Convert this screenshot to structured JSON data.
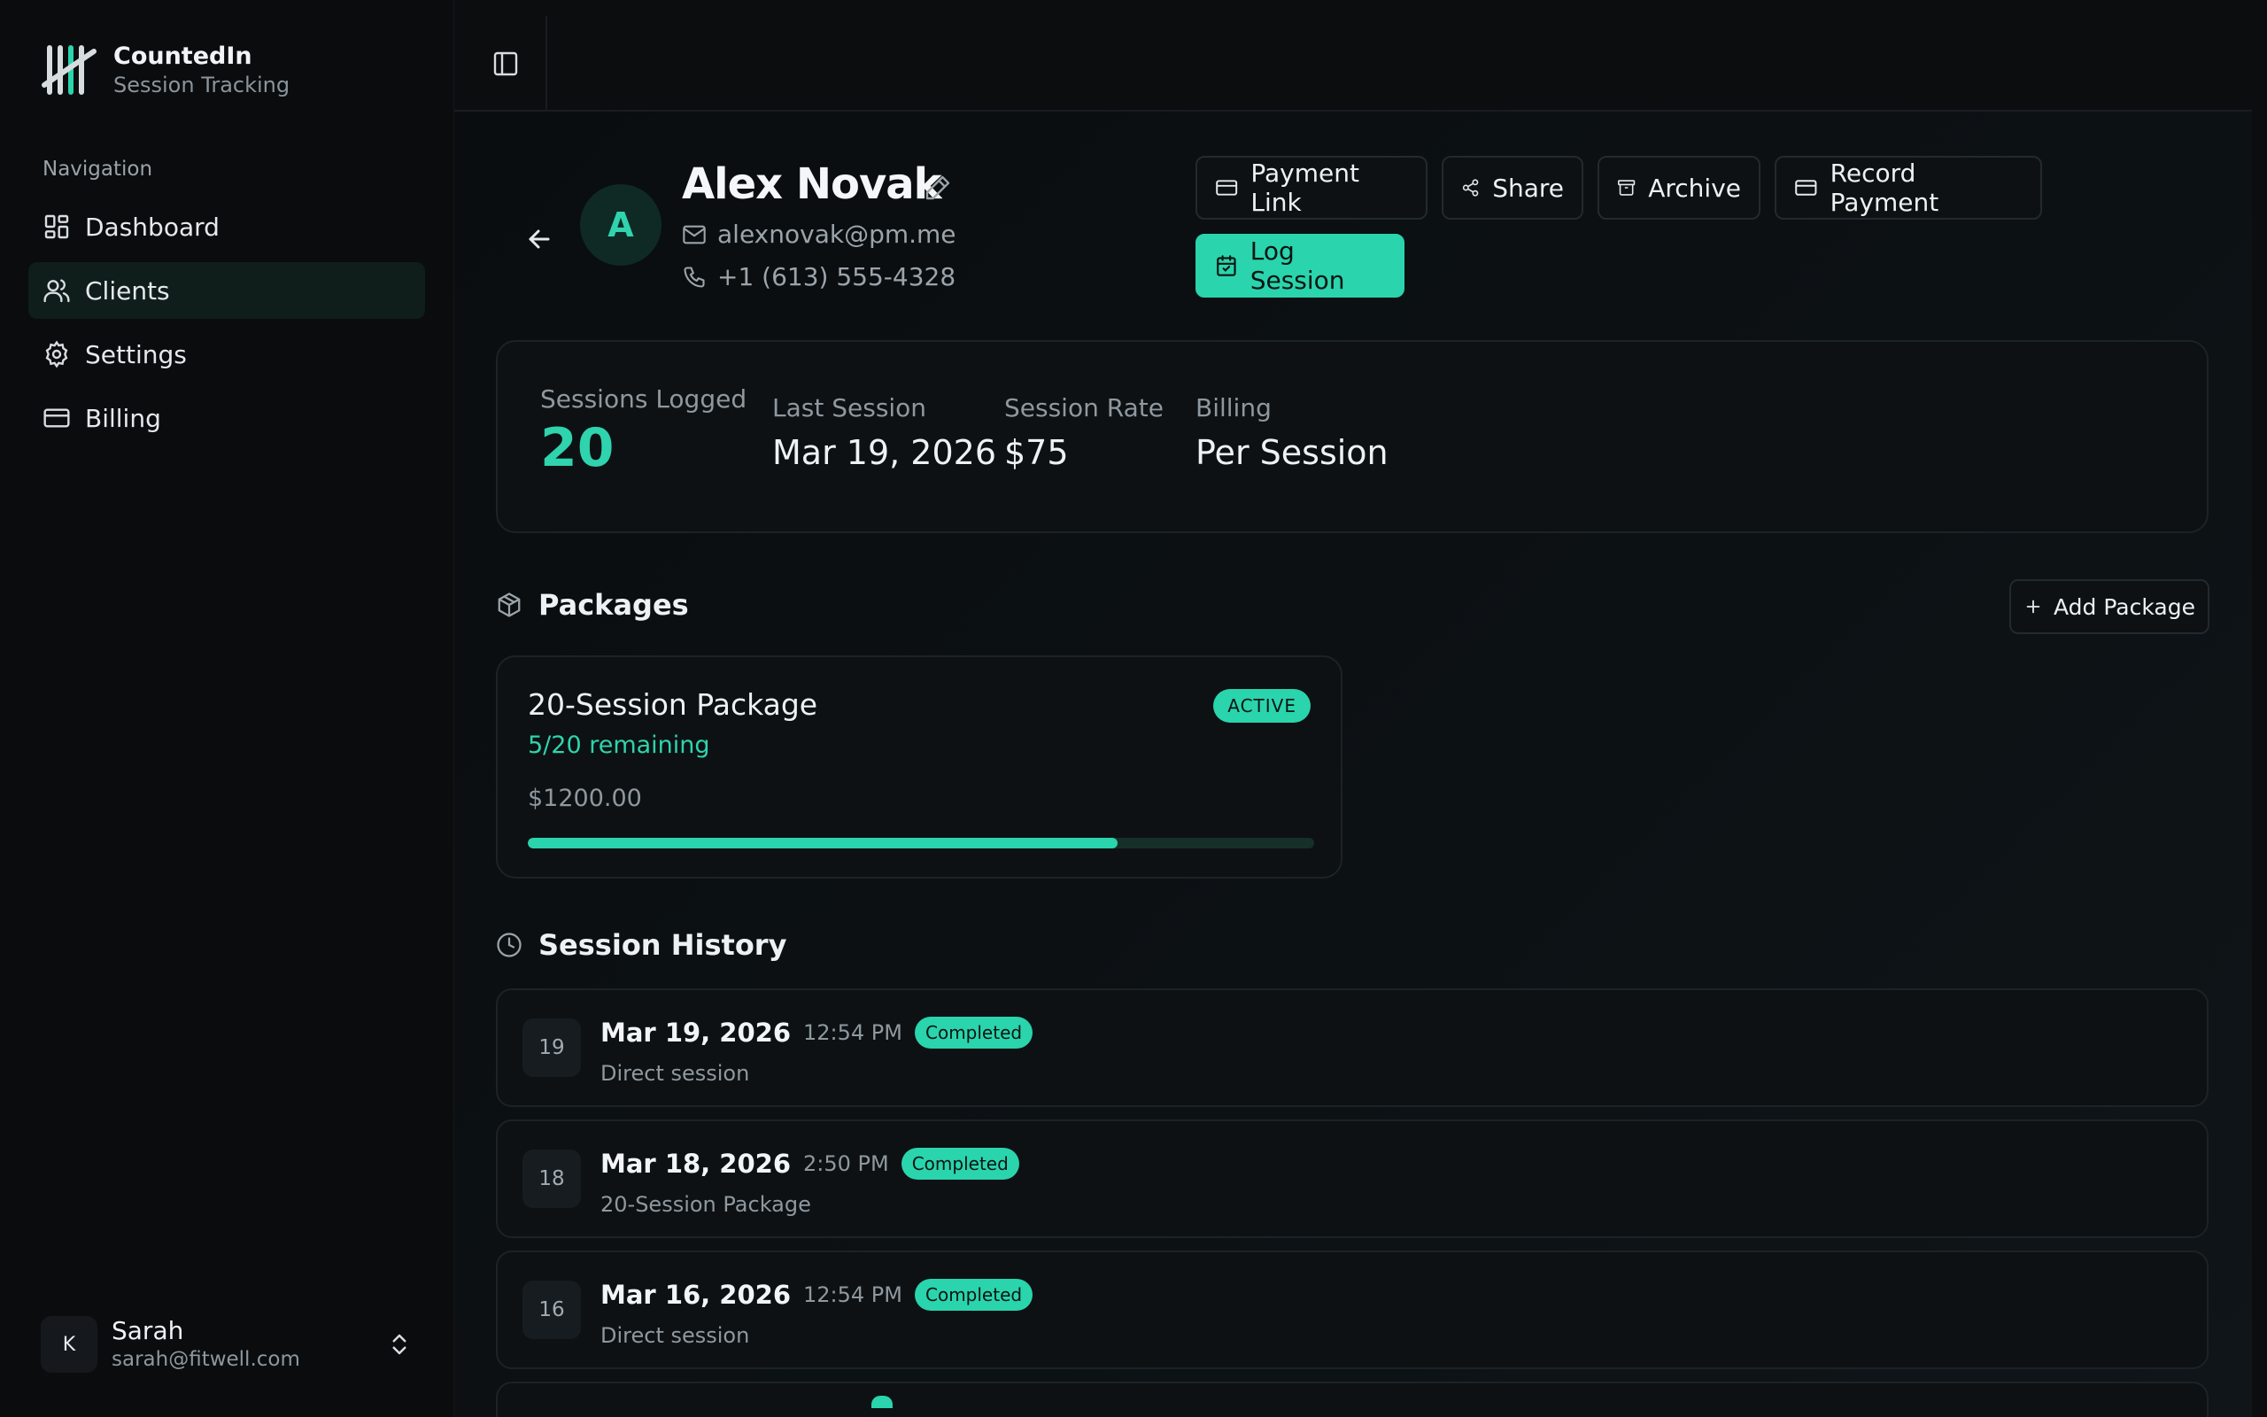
{
  "brand": {
    "name": "CountedIn",
    "subtitle": "Session Tracking"
  },
  "nav": {
    "heading": "Navigation",
    "items": [
      {
        "label": "Dashboard",
        "icon": "dashboard-icon",
        "active": false
      },
      {
        "label": "Clients",
        "icon": "users-icon",
        "active": true
      },
      {
        "label": "Settings",
        "icon": "gear-icon",
        "active": false
      },
      {
        "label": "Billing",
        "icon": "credit-card-icon",
        "active": false
      }
    ]
  },
  "user": {
    "initial": "K",
    "name": "Sarah",
    "email": "sarah@fitwell.com"
  },
  "client": {
    "initial": "A",
    "name": "Alex Novak",
    "email": "alexnovak@pm.me",
    "phone": "+1 (613) 555-4328"
  },
  "actions": {
    "payment_link": "Payment Link",
    "share": "Share",
    "archive": "Archive",
    "record_payment": "Record Payment",
    "log_session": "Log Session"
  },
  "stats": {
    "sessions_logged_label": "Sessions Logged",
    "sessions_logged_value": "20",
    "last_session_label": "Last Session",
    "last_session_value": "Mar 19, 2026",
    "session_rate_label": "Session Rate",
    "session_rate_value": "$75",
    "billing_label": "Billing",
    "billing_value": "Per Session"
  },
  "packages": {
    "title": "Packages",
    "add_label": "Add Package",
    "items": [
      {
        "name": "20-Session Package",
        "status": "ACTIVE",
        "remaining": "5/20 remaining",
        "price": "$1200.00",
        "progress_fraction": 0.75
      }
    ]
  },
  "history": {
    "title": "Session History",
    "sessions": [
      {
        "number": "19",
        "date": "Mar 19, 2026",
        "time": "12:54 PM",
        "status": "Completed",
        "type": "Direct session"
      },
      {
        "number": "18",
        "date": "Mar 18, 2026",
        "time": "2:50 PM",
        "status": "Completed",
        "type": "20-Session Package"
      },
      {
        "number": "16",
        "date": "Mar 16, 2026",
        "time": "12:54 PM",
        "status": "Completed",
        "type": "Direct session"
      }
    ]
  },
  "colors": {
    "accent": "#2ad4ad",
    "background": "#0b0d0f",
    "card_border": "#1c2226"
  }
}
